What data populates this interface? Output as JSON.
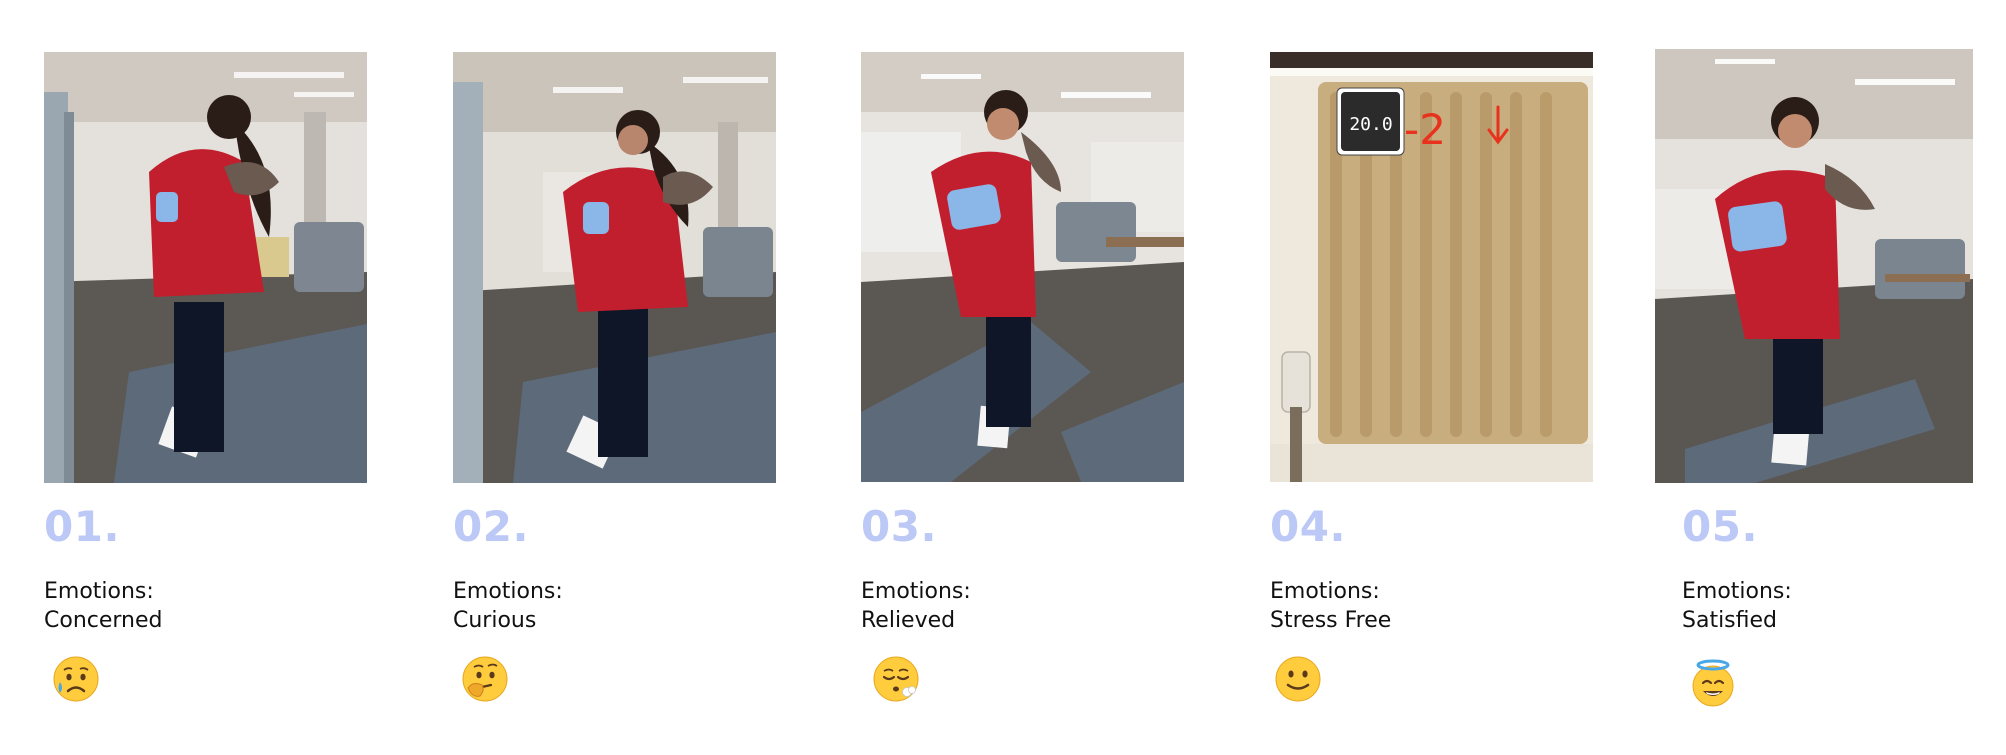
{
  "steps": [
    {
      "number": "01.",
      "label": "Emotions:",
      "emotion": "Concerned",
      "emoji": "sad-sweat-emoji-icon"
    },
    {
      "number": "02.",
      "label": "Emotions:",
      "emotion": "Curious",
      "emoji": "thinking-emoji-icon"
    },
    {
      "number": "03.",
      "label": "Emotions:",
      "emotion": "Relieved",
      "emoji": "relieved-exhale-emoji-icon"
    },
    {
      "number": "04.",
      "label": "Emotions:",
      "emotion": "Stress Free",
      "emoji": "slight-smile-emoji-icon"
    },
    {
      "number": "05.",
      "label": "Emotions:",
      "emotion": "Satisfied",
      "emoji": "halo-smile-emoji-icon"
    }
  ],
  "thermostat": {
    "display_value": "20.0",
    "annotation": "-2"
  },
  "colors": {
    "step_number": "#bcc8f5",
    "text": "#111111",
    "jacket": "#c21f2e",
    "sofa": "#5d6a7a",
    "annotation": "#e8321e"
  }
}
